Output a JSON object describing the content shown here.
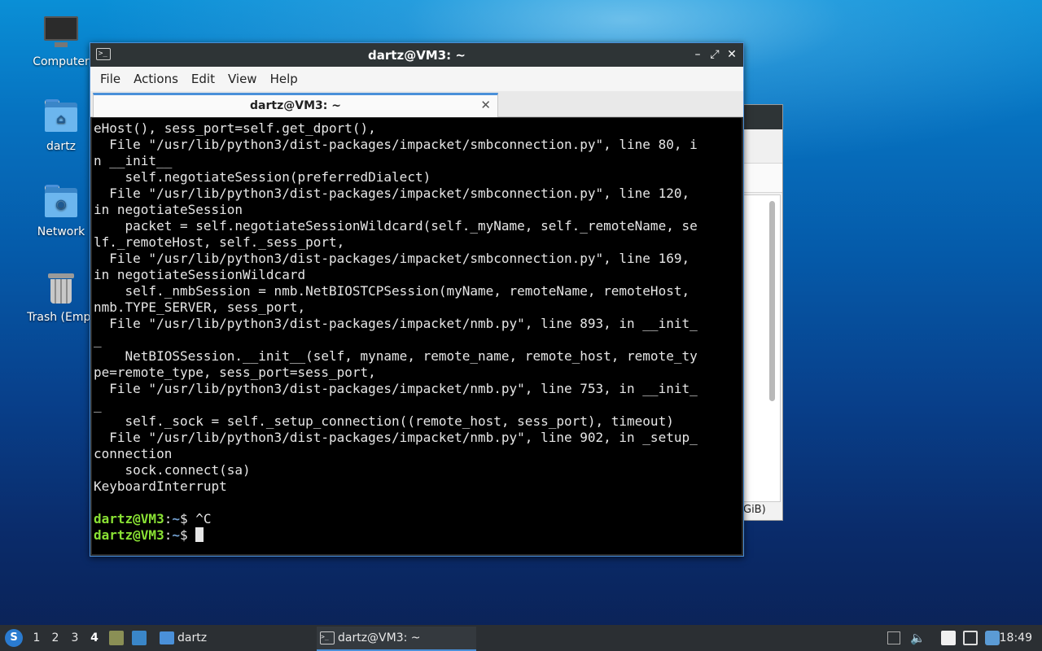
{
  "desktop": {
    "icons": [
      {
        "label": "Computer",
        "icon": "computer-icon"
      },
      {
        "label": "dartz",
        "icon": "home-folder-icon"
      },
      {
        "label": "Network",
        "icon": "network-folder-icon"
      },
      {
        "label": "Trash (Empt",
        "icon": "trash-icon"
      }
    ]
  },
  "background_window": {
    "status_text": "GiB)"
  },
  "terminal": {
    "window_title": "dartz@VM3: ~",
    "menu": [
      "File",
      "Actions",
      "Edit",
      "View",
      "Help"
    ],
    "tab_label": "dartz@VM3: ~",
    "lines": [
      "eHost(), sess_port=self.get_dport(),",
      "  File \"/usr/lib/python3/dist-packages/impacket/smbconnection.py\", line 80, i",
      "n __init__",
      "    self.negotiateSession(preferredDialect)",
      "  File \"/usr/lib/python3/dist-packages/impacket/smbconnection.py\", line 120,",
      "in negotiateSession",
      "    packet = self.negotiateSessionWildcard(self._myName, self._remoteName, se",
      "lf._remoteHost, self._sess_port,",
      "  File \"/usr/lib/python3/dist-packages/impacket/smbconnection.py\", line 169,",
      "in negotiateSessionWildcard",
      "    self._nmbSession = nmb.NetBIOSTCPSession(myName, remoteName, remoteHost,",
      "nmb.TYPE_SERVER, sess_port,",
      "  File \"/usr/lib/python3/dist-packages/impacket/nmb.py\", line 893, in __init_",
      "_",
      "    NetBIOSSession.__init__(self, myname, remote_name, remote_host, remote_ty",
      "pe=remote_type, sess_port=sess_port,",
      "  File \"/usr/lib/python3/dist-packages/impacket/nmb.py\", line 753, in __init_",
      "_",
      "    self._sock = self._setup_connection((remote_host, sess_port), timeout)",
      "  File \"/usr/lib/python3/dist-packages/impacket/nmb.py\", line 902, in _setup_",
      "connection",
      "    sock.connect(sa)",
      "KeyboardInterrupt",
      ""
    ],
    "prompts": [
      {
        "user": "dartz@VM3",
        "sep": ":",
        "path": "~",
        "tail": "$ ^C"
      },
      {
        "user": "dartz@VM3",
        "sep": ":",
        "path": "~",
        "tail": "$ "
      }
    ]
  },
  "taskbar": {
    "workspaces": [
      "1",
      "2",
      "3",
      "4"
    ],
    "active_workspace": "4",
    "tasks": [
      {
        "label": "dartz",
        "icon": "folder-icon"
      },
      {
        "label": "dartz@VM3: ~",
        "icon": "terminal-icon"
      }
    ],
    "clock": "18:49"
  }
}
